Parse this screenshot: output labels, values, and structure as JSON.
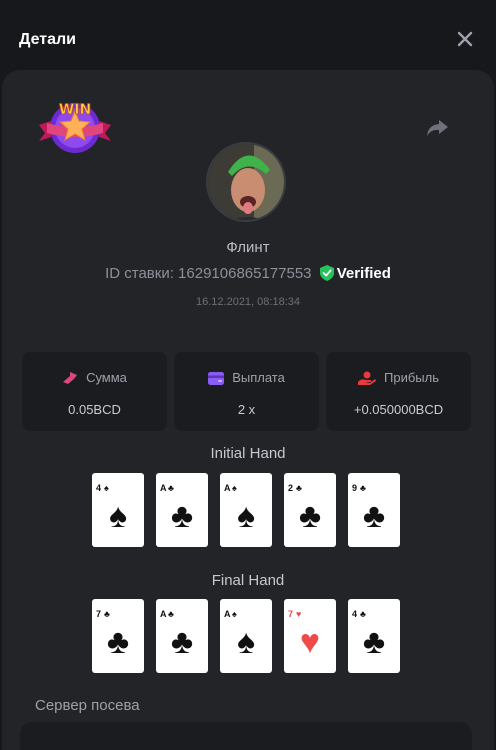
{
  "header": {
    "title": "Детали"
  },
  "badge": {
    "text": "WIN"
  },
  "player": {
    "name": "Флинт",
    "bet_id_label": "ID ставки:",
    "bet_id": "1629106865177553",
    "verified": "Verified",
    "datetime": "16.12.2021, 08:18:34"
  },
  "stats": [
    {
      "label": "Сумма",
      "value": "0.05BCD"
    },
    {
      "label": "Выплата",
      "value": "2 x"
    },
    {
      "label": "Прибыль",
      "value": "+0.050000BCD"
    }
  ],
  "initial_hand": {
    "title": "Initial Hand",
    "cards": [
      {
        "rank": "4",
        "suit": "♠"
      },
      {
        "rank": "A",
        "suit": "♣"
      },
      {
        "rank": "A",
        "suit": "♠"
      },
      {
        "rank": "2",
        "suit": "♣"
      },
      {
        "rank": "9",
        "suit": "♣"
      }
    ]
  },
  "final_hand": {
    "title": "Final Hand",
    "cards": [
      {
        "rank": "7",
        "suit": "♣"
      },
      {
        "rank": "A",
        "suit": "♣"
      },
      {
        "rank": "A",
        "suit": "♠"
      },
      {
        "rank": "7",
        "suit": "♥"
      },
      {
        "rank": "4",
        "suit": "♣"
      }
    ]
  },
  "server": {
    "label": "Сервер посева"
  },
  "colors": {
    "background": "#17181b",
    "panel": "#232428",
    "tile": "#1b1c20",
    "accent_pink": "#e0457b",
    "accent_purple": "#8a5cf6",
    "accent_red": "#e8393f",
    "verified_green": "#27c25a",
    "heart_red": "#ee4a4a"
  }
}
